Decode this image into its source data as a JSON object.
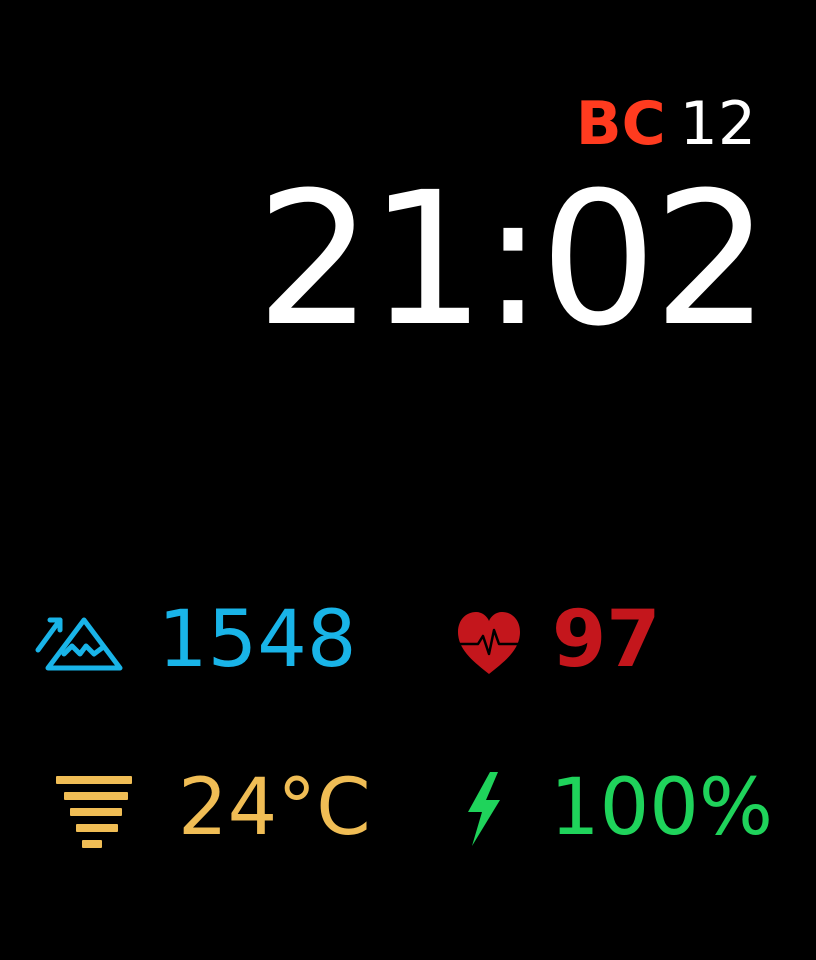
{
  "colors": {
    "background": "#000000",
    "era": "#ff3b1f",
    "text": "#ffffff",
    "elevation": "#19b4e8",
    "heart": "#c4161c",
    "temperature": "#f0bd55",
    "battery": "#1fd35b"
  },
  "date": {
    "era": "BC",
    "day": "12"
  },
  "time": "21:02",
  "metrics": {
    "elevation": {
      "icon": "mountain-elevation-icon",
      "value": "1548"
    },
    "heart_rate": {
      "icon": "heart-rate-icon",
      "value": "97"
    },
    "temperature": {
      "icon": "weather-haze-icon",
      "value": "24°C"
    },
    "battery": {
      "icon": "lightning-bolt-icon",
      "value": "100%"
    }
  }
}
